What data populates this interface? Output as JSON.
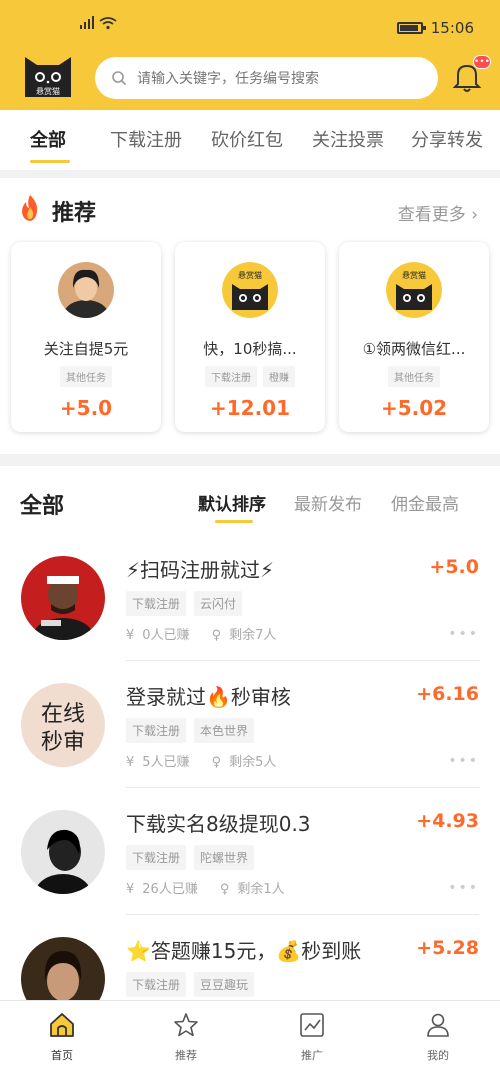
{
  "status_bar": {
    "signal": "⁴ᴳ",
    "time": "15:06"
  },
  "app": {
    "logo_text": "悬赏猫",
    "logo_face": "0.0",
    "bell_badge": "•••"
  },
  "search": {
    "placeholder": "请输入关键字，任务编号搜索"
  },
  "category_tabs": [
    "全部",
    "下载注册",
    "砍价红包",
    "关注投票",
    "分享转发"
  ],
  "recommend": {
    "title": "推荐",
    "more": "查看更多",
    "cards": [
      {
        "name": "关注自提5元",
        "tags": [
          "其他任务"
        ],
        "price": "+5.0"
      },
      {
        "name": "快，10秒搞...",
        "tags": [
          "下载注册",
          "橙赚"
        ],
        "price": "+12.01"
      },
      {
        "name": "①领两微信红...",
        "tags": [
          "其他任务"
        ],
        "price": "+5.02"
      }
    ]
  },
  "all": {
    "title": "全部",
    "sorts": [
      "默认排序",
      "最新发布",
      "佣金最高"
    ],
    "tasks": [
      {
        "title": "⚡扫码注册就过⚡",
        "price": "+5.0",
        "tags": [
          "下载注册",
          "云闪付"
        ],
        "earned": "0人已赚",
        "remaining": "剩余7人"
      },
      {
        "title": "登录就过🔥秒审核",
        "price": "+6.16",
        "tags": [
          "下载注册",
          "本色世界"
        ],
        "earned": "5人已赚",
        "remaining": "剩余5人"
      },
      {
        "title": "下载实名8级提现0.3",
        "price": "+4.93",
        "tags": [
          "下载注册",
          "陀螺世界"
        ],
        "earned": "26人已赚",
        "remaining": "剩余1人"
      },
      {
        "title": "⭐答题赚15元，💰秒到账",
        "price": "+5.28",
        "tags": [
          "下载注册",
          "豆豆趣玩"
        ],
        "earned": "",
        "remaining": ""
      }
    ],
    "avatar2_text": [
      "在线",
      "秒审"
    ]
  },
  "bottom_nav": [
    "首页",
    "推荐",
    "推广",
    "我的"
  ],
  "colors": {
    "brand": "#f7c93a",
    "price": "#ff6a2b"
  }
}
